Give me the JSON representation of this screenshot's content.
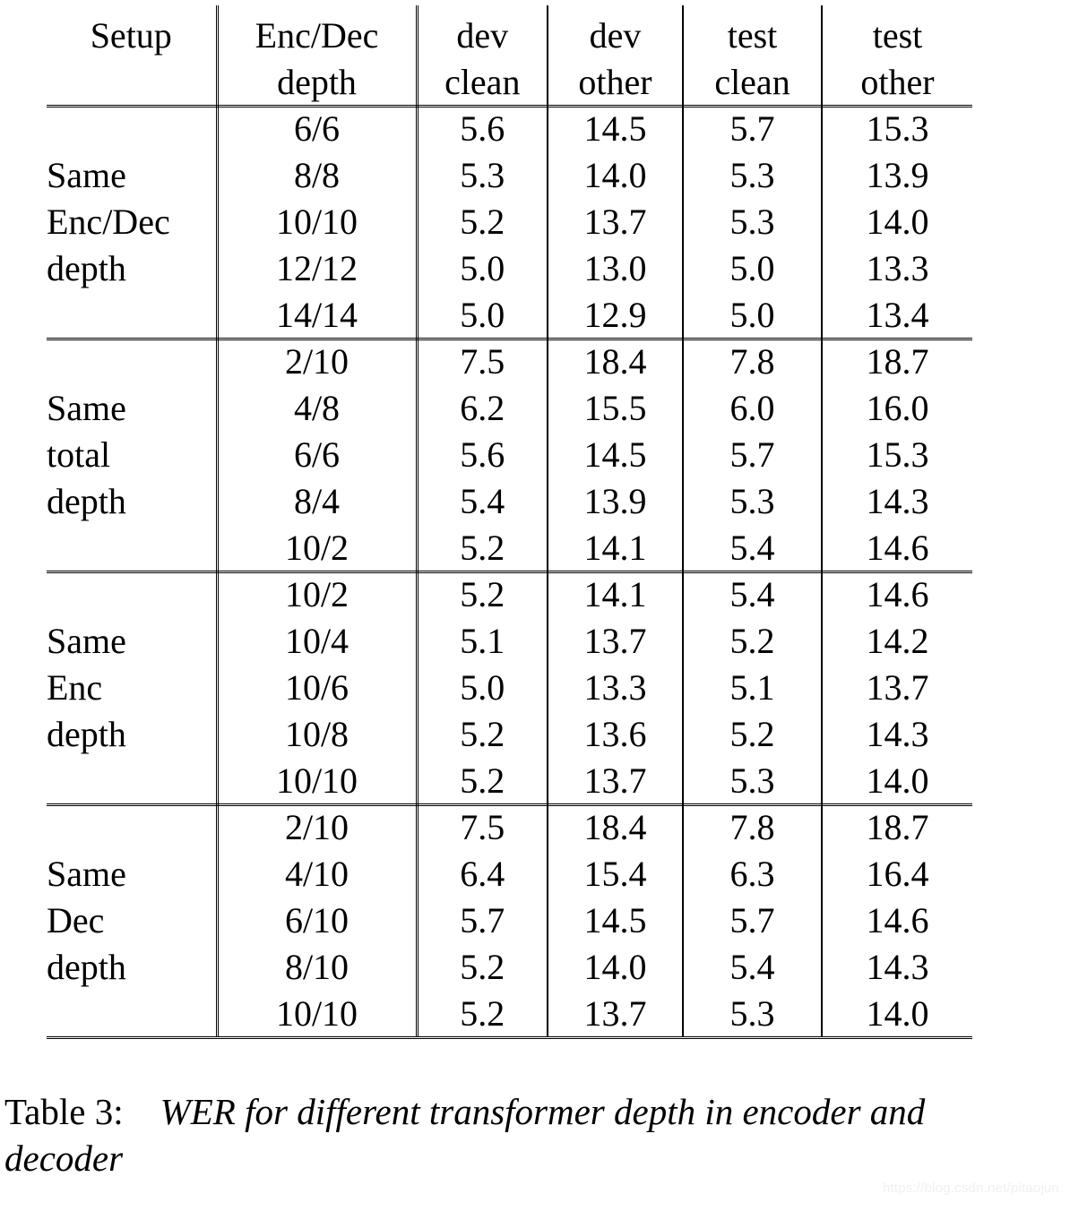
{
  "document": {
    "kind": "paper-table-figure",
    "caption_label": "Table 3:",
    "caption_text": "WER for different transformer depth in encoder and decoder",
    "watermark": "https://blog.csdn.net/pitaojun"
  },
  "table": {
    "columns": [
      {
        "key": "setup",
        "line1": "Setup",
        "line2": ""
      },
      {
        "key": "depth",
        "line1": "Enc/Dec",
        "line2": "depth"
      },
      {
        "key": "dev_clean",
        "line1": "dev",
        "line2": "clean"
      },
      {
        "key": "dev_other",
        "line1": "dev",
        "line2": "other"
      },
      {
        "key": "test_clean",
        "line1": "test",
        "line2": "clean"
      },
      {
        "key": "test_other",
        "line1": "test",
        "line2": "other"
      }
    ],
    "blocks": [
      {
        "setup_lines": [
          "Same",
          "Enc/Dec",
          "depth"
        ],
        "rows": [
          {
            "depth": "6/6",
            "dev_clean": "5.6",
            "dev_other": "14.5",
            "test_clean": "5.7",
            "test_other": "15.3"
          },
          {
            "depth": "8/8",
            "dev_clean": "5.3",
            "dev_other": "14.0",
            "test_clean": "5.3",
            "test_other": "13.9"
          },
          {
            "depth": "10/10",
            "dev_clean": "5.2",
            "dev_other": "13.7",
            "test_clean": "5.3",
            "test_other": "14.0"
          },
          {
            "depth": "12/12",
            "dev_clean": "5.0",
            "dev_other": "13.0",
            "test_clean": "5.0",
            "test_other": "13.3"
          },
          {
            "depth": "14/14",
            "dev_clean": "5.0",
            "dev_other": "12.9",
            "test_clean": "5.0",
            "test_other": "13.4"
          }
        ]
      },
      {
        "setup_lines": [
          "Same",
          "total",
          "depth"
        ],
        "rows": [
          {
            "depth": "2/10",
            "dev_clean": "7.5",
            "dev_other": "18.4",
            "test_clean": "7.8",
            "test_other": "18.7"
          },
          {
            "depth": "4/8",
            "dev_clean": "6.2",
            "dev_other": "15.5",
            "test_clean": "6.0",
            "test_other": "16.0"
          },
          {
            "depth": "6/6",
            "dev_clean": "5.6",
            "dev_other": "14.5",
            "test_clean": "5.7",
            "test_other": "15.3"
          },
          {
            "depth": "8/4",
            "dev_clean": "5.4",
            "dev_other": "13.9",
            "test_clean": "5.3",
            "test_other": "14.3"
          },
          {
            "depth": "10/2",
            "dev_clean": "5.2",
            "dev_other": "14.1",
            "test_clean": "5.4",
            "test_other": "14.6"
          }
        ]
      },
      {
        "setup_lines": [
          "Same",
          "Enc",
          "depth"
        ],
        "rows": [
          {
            "depth": "10/2",
            "dev_clean": "5.2",
            "dev_other": "14.1",
            "test_clean": "5.4",
            "test_other": "14.6"
          },
          {
            "depth": "10/4",
            "dev_clean": "5.1",
            "dev_other": "13.7",
            "test_clean": "5.2",
            "test_other": "14.2"
          },
          {
            "depth": "10/6",
            "dev_clean": "5.0",
            "dev_other": "13.3",
            "test_clean": "5.1",
            "test_other": "13.7"
          },
          {
            "depth": "10/8",
            "dev_clean": "5.2",
            "dev_other": "13.6",
            "test_clean": "5.2",
            "test_other": "14.3"
          },
          {
            "depth": "10/10",
            "dev_clean": "5.2",
            "dev_other": "13.7",
            "test_clean": "5.3",
            "test_other": "14.0"
          }
        ]
      },
      {
        "setup_lines": [
          "Same",
          "Dec",
          "depth"
        ],
        "rows": [
          {
            "depth": "2/10",
            "dev_clean": "7.5",
            "dev_other": "18.4",
            "test_clean": "7.8",
            "test_other": "18.7"
          },
          {
            "depth": "4/10",
            "dev_clean": "6.4",
            "dev_other": "15.4",
            "test_clean": "6.3",
            "test_other": "16.4"
          },
          {
            "depth": "6/10",
            "dev_clean": "5.7",
            "dev_other": "14.5",
            "test_clean": "5.7",
            "test_other": "14.6"
          },
          {
            "depth": "8/10",
            "dev_clean": "5.2",
            "dev_other": "14.0",
            "test_clean": "5.4",
            "test_other": "14.3"
          },
          {
            "depth": "10/10",
            "dev_clean": "5.2",
            "dev_other": "13.7",
            "test_clean": "5.3",
            "test_other": "14.0"
          }
        ]
      }
    ]
  },
  "chart_data": {
    "type": "table",
    "title": "WER for different transformer depth in encoder and decoder",
    "row_group_label": "Setup",
    "index_label": "Enc/Dec depth",
    "metrics": [
      "dev clean",
      "dev other",
      "test clean",
      "test other"
    ],
    "groups": [
      {
        "name": "Same Enc/Dec depth",
        "index": [
          "6/6",
          "8/8",
          "10/10",
          "12/12",
          "14/14"
        ],
        "dev_clean": [
          5.6,
          5.3,
          5.2,
          5.0,
          5.0
        ],
        "dev_other": [
          14.5,
          14.0,
          13.7,
          13.0,
          12.9
        ],
        "test_clean": [
          5.7,
          5.3,
          5.3,
          5.0,
          5.0
        ],
        "test_other": [
          15.3,
          13.9,
          14.0,
          13.3,
          13.4
        ]
      },
      {
        "name": "Same total depth",
        "index": [
          "2/10",
          "4/8",
          "6/6",
          "8/4",
          "10/2"
        ],
        "dev_clean": [
          7.5,
          6.2,
          5.6,
          5.4,
          5.2
        ],
        "dev_other": [
          18.4,
          15.5,
          14.5,
          13.9,
          14.1
        ],
        "test_clean": [
          7.8,
          6.0,
          5.7,
          5.3,
          5.4
        ],
        "test_other": [
          18.7,
          16.0,
          15.3,
          14.3,
          14.6
        ]
      },
      {
        "name": "Same Enc depth",
        "index": [
          "10/2",
          "10/4",
          "10/6",
          "10/8",
          "10/10"
        ],
        "dev_clean": [
          5.2,
          5.1,
          5.0,
          5.2,
          5.2
        ],
        "dev_other": [
          14.1,
          13.7,
          13.3,
          13.6,
          13.7
        ],
        "test_clean": [
          5.4,
          5.2,
          5.1,
          5.2,
          5.3
        ],
        "test_other": [
          14.6,
          14.2,
          13.7,
          14.3,
          14.0
        ]
      },
      {
        "name": "Same Dec depth",
        "index": [
          "2/10",
          "4/10",
          "6/10",
          "8/10",
          "10/10"
        ],
        "dev_clean": [
          7.5,
          6.4,
          5.7,
          5.2,
          5.2
        ],
        "dev_other": [
          18.4,
          15.4,
          14.5,
          14.0,
          13.7
        ],
        "test_clean": [
          7.8,
          6.3,
          5.7,
          5.4,
          5.3
        ],
        "test_other": [
          18.7,
          16.4,
          14.6,
          14.3,
          14.0
        ]
      }
    ]
  }
}
